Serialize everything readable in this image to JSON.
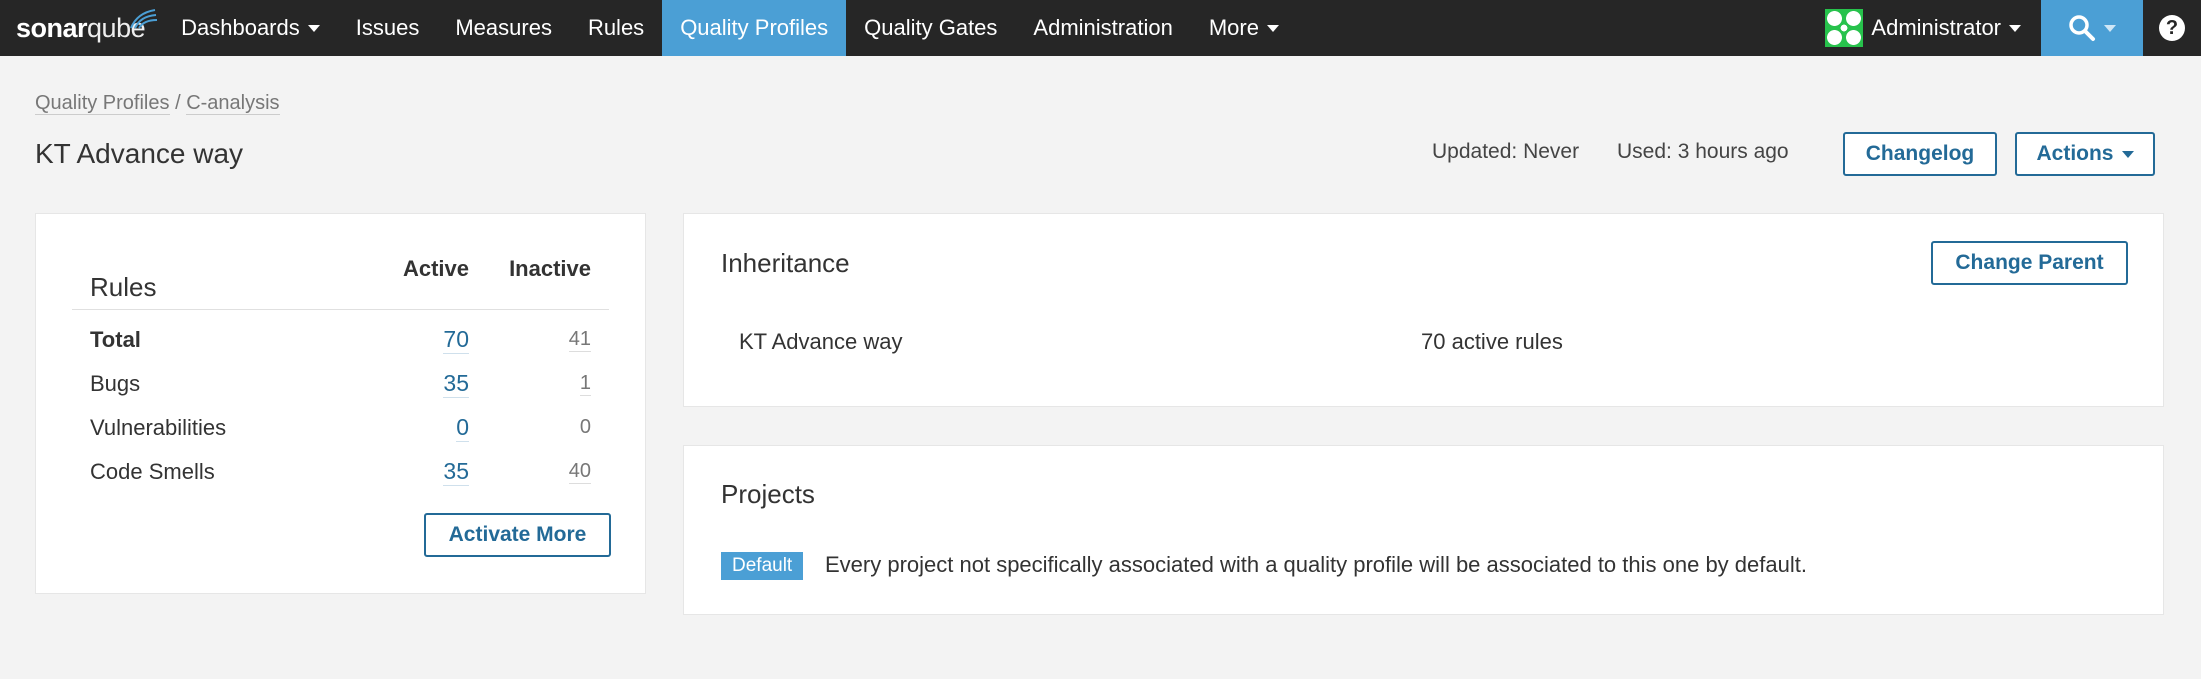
{
  "nav": {
    "logo_sonar": "sonar",
    "logo_qube": "qube",
    "items": [
      {
        "label": "Dashboards",
        "dropdown": true
      },
      {
        "label": "Issues"
      },
      {
        "label": "Measures"
      },
      {
        "label": "Rules"
      },
      {
        "label": "Quality Profiles",
        "active": true
      },
      {
        "label": "Quality Gates"
      },
      {
        "label": "Administration"
      },
      {
        "label": "More",
        "dropdown": true
      }
    ],
    "user": "Administrator",
    "help": "?",
    "colors": {
      "bar": "#262626",
      "active": "#4b9fd5"
    }
  },
  "breadcrumb": {
    "parent": "Quality Profiles",
    "separator": "/",
    "language": "C-analysis"
  },
  "profile": {
    "title": "KT Advance way",
    "updated": "Updated: Never",
    "used": "Used: 3 hours ago",
    "changelog_label": "Changelog",
    "actions_label": "Actions"
  },
  "rules": {
    "title": "Rules",
    "col_active": "Active",
    "col_inactive": "Inactive",
    "rows": [
      {
        "label": "Total",
        "active": "70",
        "inactive": "41"
      },
      {
        "label": "Bugs",
        "active": "35",
        "inactive": "1"
      },
      {
        "label": "Vulnerabilities",
        "active": "0",
        "inactive": "0"
      },
      {
        "label": "Code Smells",
        "active": "35",
        "inactive": "40"
      }
    ],
    "activate_more_label": "Activate More"
  },
  "inheritance": {
    "title": "Inheritance",
    "change_parent_label": "Change Parent",
    "profile_name": "KT Advance way",
    "active_rules": "70 active rules"
  },
  "projects": {
    "title": "Projects",
    "badge": "Default",
    "text": "Every project not specifically associated with a quality profile will be associated to this one by default."
  }
}
